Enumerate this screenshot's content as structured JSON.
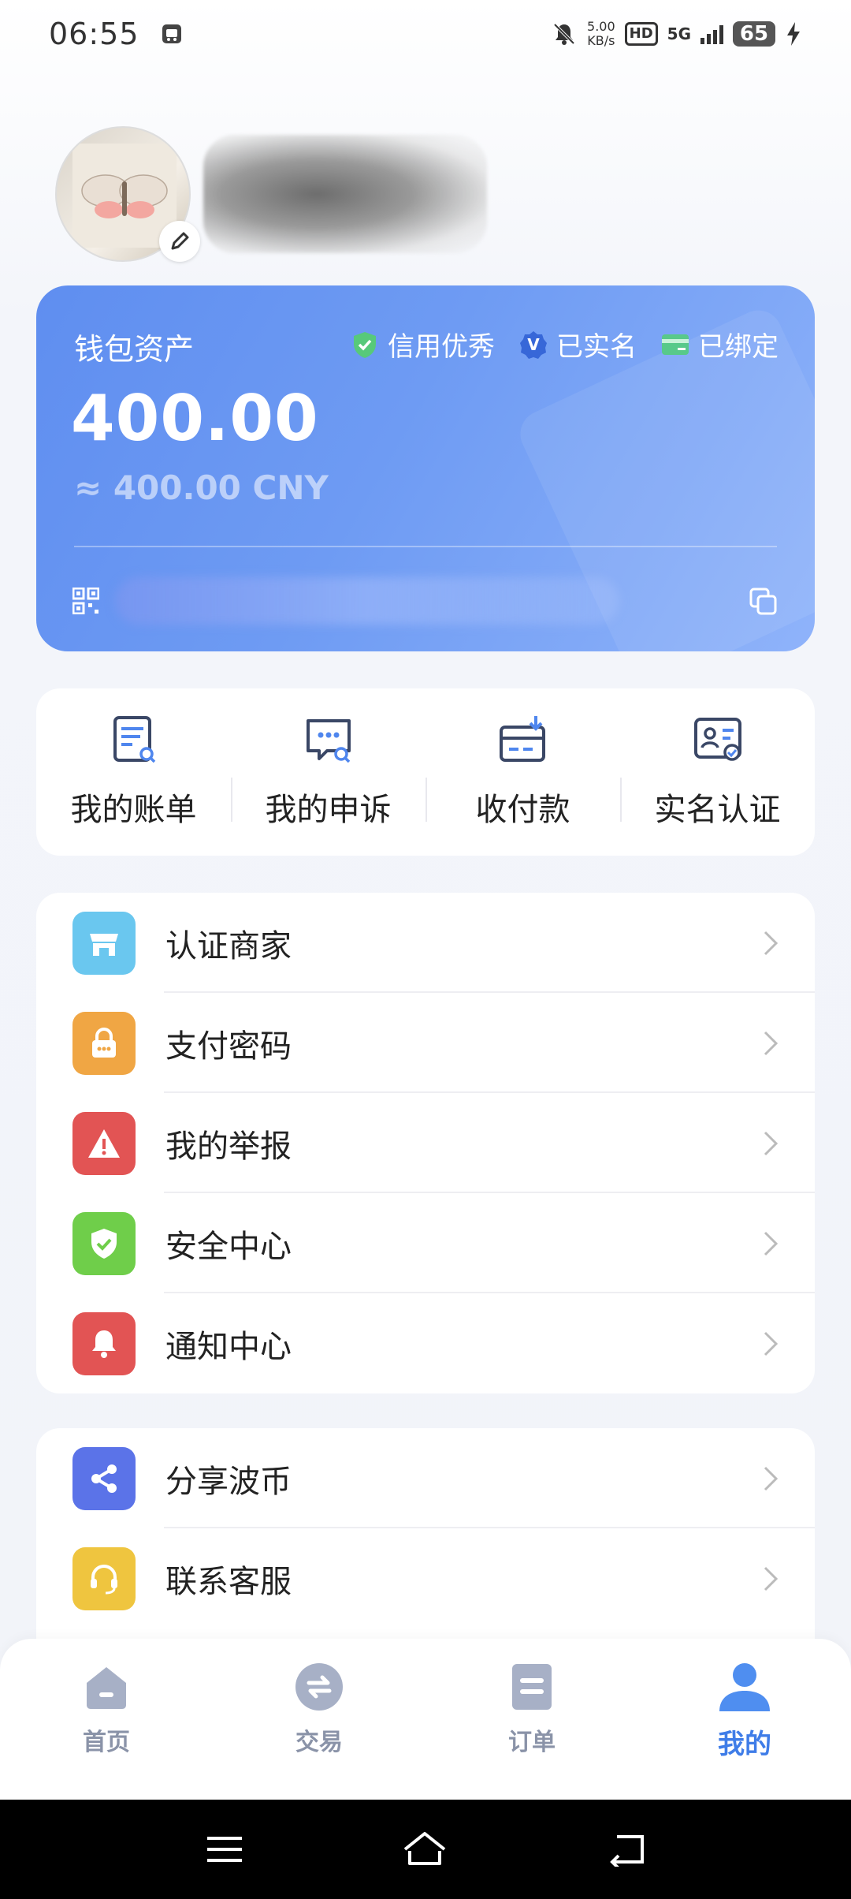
{
  "status": {
    "time": "06:55",
    "net_speed_value": "5.00",
    "net_speed_unit": "KB/s",
    "hd": "HD",
    "network": "5G",
    "battery": "65"
  },
  "wallet": {
    "title": "钱包资产",
    "badges": [
      "信用优秀",
      "已实名",
      "已绑定"
    ],
    "amount": "400.00",
    "approx": "≈ 400.00 CNY"
  },
  "quick_actions": [
    {
      "label": "我的账单",
      "icon": "bill-icon"
    },
    {
      "label": "我的申诉",
      "icon": "appeal-icon"
    },
    {
      "label": "收付款",
      "icon": "payment-icon"
    },
    {
      "label": "实名认证",
      "icon": "id-verify-icon"
    }
  ],
  "menu_group1": [
    {
      "label": "认证商家",
      "icon": "store-icon",
      "color": "#6ac7ef"
    },
    {
      "label": "支付密码",
      "icon": "lock-icon",
      "color": "#f0a644"
    },
    {
      "label": "我的举报",
      "icon": "warning-icon",
      "color": "#e25454"
    },
    {
      "label": "安全中心",
      "icon": "shield-icon",
      "color": "#6fce4a"
    },
    {
      "label": "通知中心",
      "icon": "bell-icon",
      "color": "#e25454"
    }
  ],
  "menu_group2": [
    {
      "label": "分享波币",
      "icon": "share-icon",
      "color": "#5b73e8"
    },
    {
      "label": "联系客服",
      "icon": "headset-icon",
      "color": "#efc53f"
    }
  ],
  "tabs": [
    {
      "label": "首页",
      "icon": "home-icon"
    },
    {
      "label": "交易",
      "icon": "exchange-icon"
    },
    {
      "label": "订单",
      "icon": "order-icon"
    },
    {
      "label": "我的",
      "icon": "user-icon",
      "active": true
    }
  ],
  "colors": {
    "accent": "#3f7de8",
    "wallet_start": "#5f8ef0",
    "wallet_end": "#8fb3fa",
    "tab_inactive": "#8a93a8"
  }
}
